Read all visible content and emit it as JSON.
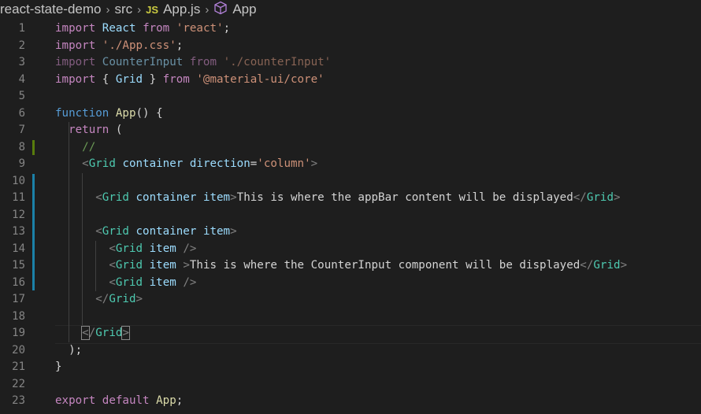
{
  "breadcrumb": {
    "project": "react-state-demo",
    "folder": "src",
    "file_badge": "JS",
    "file": "App.js",
    "symbol": "App"
  },
  "colors": {
    "background": "#1e1e1e",
    "modified_line": "#1b81a8",
    "added_line": "#587c0c"
  },
  "lines": [
    {
      "n": "1",
      "tokens": [
        {
          "t": "import",
          "c": "kw"
        },
        {
          "t": " "
        },
        {
          "t": "React",
          "c": "var"
        },
        {
          "t": " "
        },
        {
          "t": "from",
          "c": "kw"
        },
        {
          "t": " "
        },
        {
          "t": "'react'",
          "c": "str"
        },
        {
          "t": ";"
        }
      ]
    },
    {
      "n": "2",
      "tokens": [
        {
          "t": "import",
          "c": "kw"
        },
        {
          "t": " "
        },
        {
          "t": "'./App.css'",
          "c": "str"
        },
        {
          "t": ";"
        }
      ]
    },
    {
      "n": "3",
      "dim": true,
      "tokens": [
        {
          "t": "import",
          "c": "kw"
        },
        {
          "t": " "
        },
        {
          "t": "CounterInput",
          "c": "var"
        },
        {
          "t": " "
        },
        {
          "t": "from",
          "c": "kw"
        },
        {
          "t": " "
        },
        {
          "t": "'./counterInput'",
          "c": "str"
        }
      ]
    },
    {
      "n": "4",
      "tokens": [
        {
          "t": "import",
          "c": "kw"
        },
        {
          "t": " { "
        },
        {
          "t": "Grid",
          "c": "var"
        },
        {
          "t": " } "
        },
        {
          "t": "from",
          "c": "kw"
        },
        {
          "t": " "
        },
        {
          "t": "'@material-ui/core'",
          "c": "str"
        }
      ]
    },
    {
      "n": "5",
      "tokens": []
    },
    {
      "n": "6",
      "tokens": [
        {
          "t": "function",
          "c": "kw2"
        },
        {
          "t": " "
        },
        {
          "t": "App",
          "c": "fn"
        },
        {
          "t": "() {"
        }
      ]
    },
    {
      "n": "7",
      "tokens": [
        {
          "t": "  "
        },
        {
          "t": "return",
          "c": "kw"
        },
        {
          "t": " ("
        }
      ]
    },
    {
      "n": "8",
      "tokens": [
        {
          "t": "    "
        },
        {
          "t": "//",
          "c": "cmt"
        }
      ]
    },
    {
      "n": "9",
      "tokens": [
        {
          "t": "    "
        },
        {
          "t": "<",
          "c": "punct"
        },
        {
          "t": "Grid",
          "c": "tag"
        },
        {
          "t": " "
        },
        {
          "t": "container",
          "c": "var"
        },
        {
          "t": " "
        },
        {
          "t": "direction",
          "c": "var"
        },
        {
          "t": "="
        },
        {
          "t": "'column'",
          "c": "str"
        },
        {
          "t": ">",
          "c": "punct"
        }
      ]
    },
    {
      "n": "10",
      "tokens": []
    },
    {
      "n": "11",
      "tokens": [
        {
          "t": "      "
        },
        {
          "t": "<",
          "c": "punct"
        },
        {
          "t": "Grid",
          "c": "tag"
        },
        {
          "t": " "
        },
        {
          "t": "container",
          "c": "var"
        },
        {
          "t": " "
        },
        {
          "t": "item",
          "c": "var"
        },
        {
          "t": ">",
          "c": "punct"
        },
        {
          "t": "This is where the appBar content will be displayed"
        },
        {
          "t": "</",
          "c": "punct"
        },
        {
          "t": "Grid",
          "c": "tag"
        },
        {
          "t": ">",
          "c": "punct"
        }
      ]
    },
    {
      "n": "12",
      "tokens": []
    },
    {
      "n": "13",
      "tokens": [
        {
          "t": "      "
        },
        {
          "t": "<",
          "c": "punct"
        },
        {
          "t": "Grid",
          "c": "tag"
        },
        {
          "t": " "
        },
        {
          "t": "container",
          "c": "var"
        },
        {
          "t": " "
        },
        {
          "t": "item",
          "c": "var"
        },
        {
          "t": ">",
          "c": "punct"
        }
      ]
    },
    {
      "n": "14",
      "tokens": [
        {
          "t": "        "
        },
        {
          "t": "<",
          "c": "punct"
        },
        {
          "t": "Grid",
          "c": "tag"
        },
        {
          "t": " "
        },
        {
          "t": "item",
          "c": "var"
        },
        {
          "t": " "
        },
        {
          "t": "/>",
          "c": "punct"
        }
      ]
    },
    {
      "n": "15",
      "tokens": [
        {
          "t": "        "
        },
        {
          "t": "<",
          "c": "punct"
        },
        {
          "t": "Grid",
          "c": "tag"
        },
        {
          "t": " "
        },
        {
          "t": "item",
          "c": "var"
        },
        {
          "t": " "
        },
        {
          "t": ">",
          "c": "punct"
        },
        {
          "t": "This is where the CounterInput component will be displayed"
        },
        {
          "t": "</",
          "c": "punct"
        },
        {
          "t": "Grid",
          "c": "tag"
        },
        {
          "t": ">",
          "c": "punct"
        }
      ]
    },
    {
      "n": "16",
      "tokens": [
        {
          "t": "        "
        },
        {
          "t": "<",
          "c": "punct"
        },
        {
          "t": "Grid",
          "c": "tag"
        },
        {
          "t": " "
        },
        {
          "t": "item",
          "c": "var"
        },
        {
          "t": " "
        },
        {
          "t": "/>",
          "c": "punct"
        }
      ]
    },
    {
      "n": "17",
      "tokens": [
        {
          "t": "      "
        },
        {
          "t": "</",
          "c": "punct"
        },
        {
          "t": "Grid",
          "c": "tag"
        },
        {
          "t": ">",
          "c": "punct"
        }
      ]
    },
    {
      "n": "18",
      "tokens": []
    },
    {
      "n": "19",
      "tokens": [
        {
          "t": "    "
        },
        {
          "t": "<",
          "c": "punct bracket-hl"
        },
        {
          "t": "/",
          "c": "punct"
        },
        {
          "t": "Grid",
          "c": "tag"
        },
        {
          "t": ">",
          "c": "punct bracket-hl"
        }
      ]
    },
    {
      "n": "20",
      "tokens": [
        {
          "t": "  );"
        }
      ]
    },
    {
      "n": "21",
      "tokens": [
        {
          "t": "}"
        }
      ]
    },
    {
      "n": "22",
      "tokens": []
    },
    {
      "n": "23",
      "tokens": [
        {
          "t": "export",
          "c": "kw"
        },
        {
          "t": " "
        },
        {
          "t": "default",
          "c": "kw"
        },
        {
          "t": " "
        },
        {
          "t": "App",
          "c": "fn"
        },
        {
          "t": ";"
        }
      ]
    }
  ],
  "gutter_marks": [
    {
      "from": 8,
      "to": 8,
      "kind": "added"
    },
    {
      "from": 10,
      "to": 16,
      "kind": "modified"
    }
  ]
}
